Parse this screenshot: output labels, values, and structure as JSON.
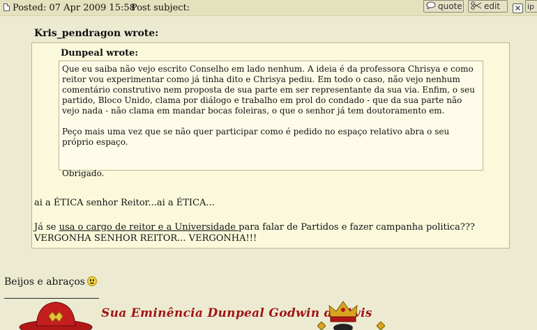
{
  "header": {
    "posted": "Posted: 07 Apr 2009 15:58",
    "subject_label": "Post subject:",
    "quote_btn": "quote",
    "edit_btn": "edit",
    "close_btn": "✕",
    "ip_btn": "ip"
  },
  "outer_quote": {
    "author": "Kris_pendragon wrote:"
  },
  "inner_quote": {
    "author": "Dunpeal wrote:",
    "paragraph1": "Que eu saiba não vejo escrito Conselho em lado nenhum. A ideia é da professora Chrisya e como reitor vou experimentar como já tinha dito e Chrisya pediu. Em todo o caso, não vejo nenhum comentário construtivo nem proposta de sua parte em ser representante da sua via. Enfim, o seu partido, Bloco Unido, clama por diálogo e trabalho em prol do condado - que da sua parte não vejo nada - não clama em mandar bocas foleiras, o que o senhor já tem doutoramento em.",
    "paragraph2": "Peço mais uma vez que se não quer participar como é pedido no espaço relativo abra o seu próprio espaço.",
    "paragraph3": "Obrigado."
  },
  "reply": {
    "line1": "ai a ÉTICA senhor Reitor...ai a ÉTICA...",
    "line2_prefix": "Já se ",
    "line2_link": "usa o cargo de reitor e a Universidade ",
    "line2_suffix": "para falar de Partidos e fazer campanha politica??? VERGONHA SENHOR REITOR... VERGONHA!!!"
  },
  "post_footer": {
    "kisses": "Beijos e abraços",
    "signature": "Sua Eminência Dunpeal Godwin de Avis"
  },
  "colors": {
    "background": "#ECEBD2",
    "quote_background": "#FBF9DC",
    "signature_red": "#A11515"
  }
}
